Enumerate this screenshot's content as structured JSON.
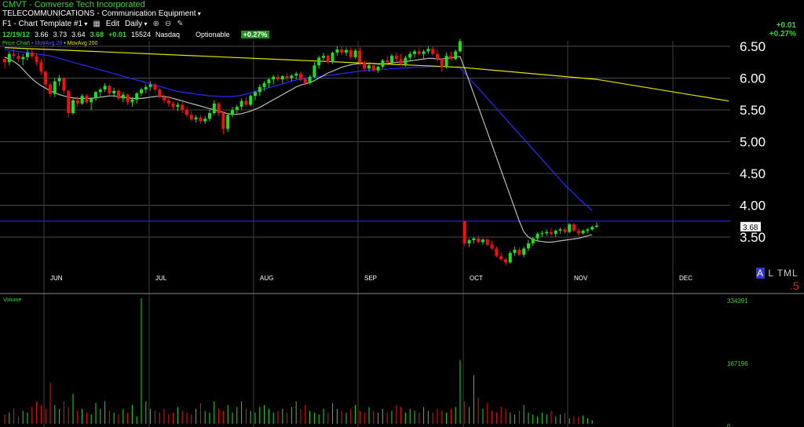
{
  "header": {
    "title": "CMVT - Comverse Tech Incorporated",
    "sector": "TELECOMMUNICATIONS - Communication Equipment",
    "template": "F1 - Chart Template #1",
    "edit_label": "Edit",
    "period": "Daily",
    "zoom_in_icon": "zoom-in-icon",
    "zoom_out_icon": "zoom-out-icon",
    "draw_icon": "pencil-icon"
  },
  "quote": {
    "date": "12/19/12",
    "open": "3.66",
    "high": "3.73",
    "low": "3.64",
    "close": "3.68",
    "change": "+0.01",
    "volume": "15524",
    "exchange": "Nasdaq",
    "optionable": "Optionable",
    "percent_badge": "+0.27%"
  },
  "top_right": {
    "change": "+0.01",
    "percent": "+0.27%"
  },
  "legend": {
    "price": "Price Chart",
    "ma20": "MovAvg 20",
    "ma200": "MovAvg 200"
  },
  "side_labels": {
    "a": "A",
    "ltml": "L TML",
    "five": ".5"
  },
  "colors": {
    "up": "#22dd22",
    "down": "#ee1111",
    "ma20": "#bbbbbb",
    "ma50": "#2a2aff",
    "ma200": "#e6e600",
    "grid": "#4a4a4a",
    "axis_text": "#ffffff",
    "volume_axis": "#3bd43b"
  },
  "chart_data": {
    "type": "candlestick",
    "price_axis": {
      "ticks": [
        "6.50",
        "6.00",
        "5.50",
        "5.00",
        "4.50",
        "4.00",
        "3.50"
      ],
      "ylim": [
        3.25,
        6.65
      ]
    },
    "months": [
      "JUN",
      "JUL",
      "AUG",
      "SEP",
      "OCT",
      "NOV",
      "DEC"
    ],
    "last_price_label": "3.68",
    "last_price": 3.75,
    "volume_axis": {
      "ticks": [
        "334391",
        "167196",
        "0"
      ],
      "max": 334391
    },
    "candles": [
      [
        6.3,
        6.35,
        6.15,
        6.25
      ],
      [
        6.25,
        6.42,
        6.2,
        6.38
      ],
      [
        6.38,
        6.45,
        6.3,
        6.35
      ],
      [
        6.35,
        6.4,
        6.25,
        6.3
      ],
      [
        6.3,
        6.38,
        6.2,
        6.33
      ],
      [
        6.33,
        6.45,
        6.28,
        6.4
      ],
      [
        6.4,
        6.45,
        6.3,
        6.34
      ],
      [
        6.34,
        6.38,
        6.2,
        6.25
      ],
      [
        6.25,
        6.3,
        6.05,
        6.1
      ],
      [
        6.1,
        6.12,
        5.85,
        5.9
      ],
      [
        5.9,
        5.95,
        5.7,
        5.75
      ],
      [
        5.75,
        6.0,
        5.7,
        5.95
      ],
      [
        5.95,
        6.05,
        5.88,
        6.0
      ],
      [
        6.0,
        6.02,
        5.75,
        5.8
      ],
      [
        5.8,
        5.82,
        5.38,
        5.45
      ],
      [
        5.45,
        5.7,
        5.42,
        5.65
      ],
      [
        5.65,
        5.72,
        5.55,
        5.6
      ],
      [
        5.6,
        5.75,
        5.58,
        5.72
      ],
      [
        5.72,
        5.75,
        5.6,
        5.62
      ],
      [
        5.62,
        5.7,
        5.5,
        5.68
      ],
      [
        5.68,
        5.8,
        5.64,
        5.78
      ],
      [
        5.78,
        5.85,
        5.7,
        5.82
      ],
      [
        5.82,
        5.92,
        5.78,
        5.88
      ],
      [
        5.88,
        5.9,
        5.72,
        5.76
      ],
      [
        5.76,
        5.85,
        5.7,
        5.8
      ],
      [
        5.8,
        5.83,
        5.65,
        5.68
      ],
      [
        5.68,
        5.78,
        5.62,
        5.74
      ],
      [
        5.74,
        5.76,
        5.58,
        5.62
      ],
      [
        5.62,
        5.7,
        5.55,
        5.66
      ],
      [
        5.66,
        5.78,
        5.6,
        5.76
      ],
      [
        5.76,
        5.85,
        5.72,
        5.82
      ],
      [
        5.82,
        5.9,
        5.76,
        5.86
      ],
      [
        5.86,
        5.95,
        5.8,
        5.9
      ],
      [
        5.9,
        5.92,
        5.78,
        5.82
      ],
      [
        5.82,
        5.85,
        5.68,
        5.7
      ],
      [
        5.7,
        5.75,
        5.6,
        5.65
      ],
      [
        5.65,
        5.72,
        5.55,
        5.6
      ],
      [
        5.6,
        5.64,
        5.5,
        5.55
      ],
      [
        5.55,
        5.62,
        5.48,
        5.58
      ],
      [
        5.58,
        5.62,
        5.45,
        5.5
      ],
      [
        5.5,
        5.55,
        5.38,
        5.42
      ],
      [
        5.42,
        5.48,
        5.32,
        5.35
      ],
      [
        5.35,
        5.42,
        5.3,
        5.38
      ],
      [
        5.38,
        5.42,
        5.28,
        5.32
      ],
      [
        5.32,
        5.4,
        5.28,
        5.36
      ],
      [
        5.36,
        5.5,
        5.32,
        5.45
      ],
      [
        5.45,
        5.65,
        5.42,
        5.6
      ],
      [
        5.6,
        5.62,
        5.4,
        5.45
      ],
      [
        5.45,
        5.48,
        5.12,
        5.2
      ],
      [
        5.2,
        5.45,
        5.15,
        5.42
      ],
      [
        5.42,
        5.55,
        5.38,
        5.5
      ],
      [
        5.5,
        5.58,
        5.44,
        5.55
      ],
      [
        5.55,
        5.68,
        5.5,
        5.64
      ],
      [
        5.64,
        5.7,
        5.55,
        5.58
      ],
      [
        5.58,
        5.75,
        5.55,
        5.72
      ],
      [
        5.72,
        5.8,
        5.65,
        5.78
      ],
      [
        5.78,
        5.9,
        5.72,
        5.86
      ],
      [
        5.86,
        5.95,
        5.8,
        5.92
      ],
      [
        5.92,
        6.0,
        5.85,
        5.98
      ],
      [
        5.98,
        6.05,
        5.9,
        6.02
      ],
      [
        6.02,
        6.06,
        5.95,
        5.98
      ],
      [
        5.98,
        6.05,
        5.92,
        6.03
      ],
      [
        6.03,
        6.08,
        5.96,
        6.0
      ],
      [
        6.0,
        6.06,
        5.95,
        6.04
      ],
      [
        6.04,
        6.1,
        5.98,
        6.07
      ],
      [
        6.07,
        6.1,
        5.95,
        5.98
      ],
      [
        5.98,
        6.02,
        5.88,
        5.92
      ],
      [
        5.92,
        6.05,
        5.9,
        6.02
      ],
      [
        6.02,
        6.25,
        6.0,
        6.2
      ],
      [
        6.2,
        6.35,
        6.15,
        6.32
      ],
      [
        6.32,
        6.4,
        6.28,
        6.35
      ],
      [
        6.35,
        6.38,
        6.22,
        6.25
      ],
      [
        6.25,
        6.42,
        6.22,
        6.4
      ],
      [
        6.4,
        6.5,
        6.35,
        6.45
      ],
      [
        6.45,
        6.5,
        6.36,
        6.4
      ],
      [
        6.4,
        6.48,
        6.35,
        6.44
      ],
      [
        6.44,
        6.48,
        6.3,
        6.33
      ],
      [
        6.33,
        6.46,
        6.3,
        6.43
      ],
      [
        6.43,
        6.48,
        6.2,
        6.25
      ],
      [
        6.25,
        6.28,
        6.1,
        6.15
      ],
      [
        6.15,
        6.25,
        6.1,
        6.2
      ],
      [
        6.2,
        6.22,
        6.1,
        6.12
      ],
      [
        6.12,
        6.2,
        6.08,
        6.18
      ],
      [
        6.18,
        6.3,
        6.15,
        6.28
      ],
      [
        6.28,
        6.35,
        6.2,
        6.25
      ],
      [
        6.25,
        6.38,
        6.22,
        6.35
      ],
      [
        6.35,
        6.4,
        6.25,
        6.3
      ],
      [
        6.3,
        6.38,
        6.2,
        6.22
      ],
      [
        6.22,
        6.35,
        6.18,
        6.32
      ],
      [
        6.32,
        6.42,
        6.28,
        6.38
      ],
      [
        6.38,
        6.45,
        6.32,
        6.42
      ],
      [
        6.42,
        6.48,
        6.35,
        6.38
      ],
      [
        6.38,
        6.45,
        6.3,
        6.42
      ],
      [
        6.42,
        6.5,
        6.38,
        6.46
      ],
      [
        6.46,
        6.5,
        6.35,
        6.38
      ],
      [
        6.38,
        6.45,
        6.25,
        6.3
      ],
      [
        6.3,
        6.32,
        6.1,
        6.18
      ],
      [
        6.18,
        6.4,
        6.15,
        6.35
      ],
      [
        6.35,
        6.42,
        6.28,
        6.3
      ],
      [
        6.3,
        6.45,
        6.28,
        6.42
      ],
      [
        6.42,
        6.62,
        6.4,
        6.58
      ],
      [
        3.75,
        3.75,
        3.35,
        3.4
      ],
      [
        3.4,
        3.48,
        3.34,
        3.45
      ],
      [
        3.45,
        3.5,
        3.4,
        3.48
      ],
      [
        3.48,
        3.52,
        3.4,
        3.42
      ],
      [
        3.42,
        3.48,
        3.38,
        3.46
      ],
      [
        3.46,
        3.48,
        3.36,
        3.38
      ],
      [
        3.38,
        3.44,
        3.3,
        3.32
      ],
      [
        3.32,
        3.35,
        3.18,
        3.2
      ],
      [
        3.2,
        3.25,
        3.12,
        3.15
      ],
      [
        3.15,
        3.18,
        3.05,
        3.1
      ],
      [
        3.1,
        3.28,
        3.08,
        3.25
      ],
      [
        3.25,
        3.35,
        3.2,
        3.3
      ],
      [
        3.3,
        3.34,
        3.2,
        3.22
      ],
      [
        3.22,
        3.35,
        3.18,
        3.32
      ],
      [
        3.32,
        3.45,
        3.28,
        3.4
      ],
      [
        3.4,
        3.5,
        3.36,
        3.48
      ],
      [
        3.48,
        3.58,
        3.44,
        3.55
      ],
      [
        3.55,
        3.6,
        3.5,
        3.56
      ],
      [
        3.56,
        3.62,
        3.52,
        3.58
      ],
      [
        3.58,
        3.64,
        3.5,
        3.55
      ],
      [
        3.55,
        3.62,
        3.5,
        3.6
      ],
      [
        3.6,
        3.65,
        3.55,
        3.62
      ],
      [
        3.62,
        3.66,
        3.55,
        3.58
      ],
      [
        3.58,
        3.72,
        3.56,
        3.7
      ],
      [
        3.7,
        3.72,
        3.58,
        3.6
      ],
      [
        3.6,
        3.64,
        3.52,
        3.56
      ],
      [
        3.56,
        3.62,
        3.54,
        3.6
      ],
      [
        3.6,
        3.64,
        3.56,
        3.62
      ],
      [
        3.62,
        3.68,
        3.6,
        3.66
      ],
      [
        3.66,
        3.73,
        3.64,
        3.68
      ]
    ],
    "ma20": [
      6.33,
      6.3,
      6.26,
      6.21,
      6.14,
      6.06,
      5.99,
      5.93,
      5.88,
      5.84,
      5.8,
      5.77,
      5.74,
      5.72,
      5.7,
      5.69,
      5.68,
      5.68,
      5.68,
      5.68,
      5.69,
      5.7,
      5.71,
      5.72,
      5.72,
      5.71,
      5.7,
      5.69,
      5.68,
      5.68,
      5.68,
      5.69,
      5.7,
      5.71,
      5.72,
      5.71,
      5.7,
      5.68,
      5.66,
      5.64,
      5.62,
      5.6,
      5.58,
      5.56,
      5.54,
      5.52,
      5.5,
      5.48,
      5.46,
      5.44,
      5.43,
      5.43,
      5.44,
      5.46,
      5.48,
      5.51,
      5.54,
      5.58,
      5.62,
      5.66,
      5.7,
      5.74,
      5.78,
      5.82,
      5.86,
      5.89,
      5.91,
      5.93,
      5.96,
      6.0,
      6.04,
      6.08,
      6.11,
      6.14,
      6.17,
      6.19,
      6.21,
      6.22,
      6.23,
      6.23,
      6.23,
      6.23,
      6.22,
      6.22,
      6.23,
      6.24,
      6.25,
      6.25,
      6.26,
      6.27,
      6.28,
      6.29,
      6.3,
      6.31,
      6.31,
      6.3,
      6.3,
      6.31,
      6.32,
      6.33,
      6.34,
      6.15,
      5.95,
      5.75,
      5.55,
      5.35,
      5.15,
      4.95,
      4.75,
      4.55,
      4.35,
      4.15,
      3.95,
      3.75,
      3.58,
      3.5,
      3.46,
      3.44,
      3.43,
      3.42,
      3.42,
      3.43,
      3.44,
      3.45,
      3.46,
      3.47,
      3.48,
      3.5,
      3.52,
      3.54
    ],
    "ma50": [
      6.45,
      6.44,
      6.43,
      6.42,
      6.41,
      6.4,
      6.39,
      6.38,
      6.37,
      6.36,
      6.35,
      6.33,
      6.31,
      6.29,
      6.27,
      6.25,
      6.23,
      6.21,
      6.19,
      6.17,
      6.15,
      6.13,
      6.11,
      6.09,
      6.07,
      6.05,
      6.03,
      6.01,
      5.99,
      5.97,
      5.95,
      5.93,
      5.91,
      5.89,
      5.87,
      5.85,
      5.83,
      5.81,
      5.79,
      5.78,
      5.77,
      5.76,
      5.75,
      5.74,
      5.73,
      5.72,
      5.72,
      5.71,
      5.71,
      5.71,
      5.71,
      5.72,
      5.73,
      5.75,
      5.77,
      5.79,
      5.81,
      5.83,
      5.85,
      5.87,
      5.89,
      5.91,
      5.93,
      5.95,
      5.97,
      5.98,
      5.99,
      6.0,
      6.01,
      6.02,
      6.03,
      6.04,
      6.05,
      6.06,
      6.07,
      6.08,
      6.09,
      6.1,
      6.11,
      6.12,
      6.12,
      6.13,
      6.13,
      6.14,
      6.14,
      6.15,
      6.15,
      6.16,
      6.16,
      6.16,
      6.17,
      6.17,
      6.17,
      6.18,
      6.18,
      6.18,
      6.18,
      6.18,
      6.17,
      6.17,
      6.16,
      6.08,
      6.0,
      5.92,
      5.84,
      5.76,
      5.68,
      5.6,
      5.52,
      5.44,
      5.36,
      5.28,
      5.2,
      5.12,
      5.04,
      4.96,
      4.88,
      4.8,
      4.72,
      4.64,
      4.56,
      4.48,
      4.4,
      4.32,
      4.25,
      4.18,
      4.11,
      4.04,
      3.98,
      3.92
    ],
    "ma200_points": [
      [
        0,
        6.48
      ],
      [
        100,
        6.17
      ],
      [
        130,
        5.98
      ],
      [
        159,
        5.64
      ]
    ],
    "volume": [
      25,
      30,
      40,
      20,
      35,
      30,
      45,
      60,
      50,
      40,
      110,
      50,
      40,
      60,
      45,
      80,
      35,
      40,
      30,
      25,
      55,
      40,
      60,
      35,
      30,
      25,
      40,
      30,
      50,
      20,
      334,
      60,
      40,
      35,
      30,
      40,
      25,
      30,
      45,
      35,
      30,
      25,
      40,
      55,
      35,
      30,
      60,
      40,
      35,
      50,
      30,
      45,
      60,
      40,
      35,
      30,
      45,
      50,
      40,
      30,
      35,
      40,
      30,
      45,
      60,
      40,
      50,
      35,
      30,
      25,
      40,
      30,
      55,
      40,
      35,
      30,
      40,
      50,
      35,
      30,
      45,
      35,
      30,
      40,
      30,
      35,
      50,
      45,
      30,
      40,
      35,
      30,
      45,
      35,
      30,
      40,
      35,
      30,
      40,
      45,
      170,
      60,
      45,
      130,
      70,
      40,
      55,
      35,
      30,
      45,
      40,
      30,
      25,
      35,
      50,
      30,
      25,
      20,
      30,
      25,
      35,
      20,
      25,
      30,
      15,
      20,
      18,
      22,
      15,
      10
    ]
  }
}
